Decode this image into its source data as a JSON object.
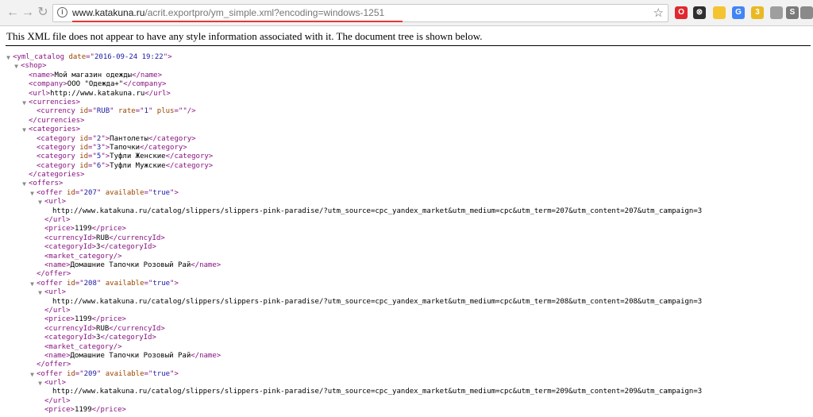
{
  "browser": {
    "url_host": "www.katakuna.ru",
    "url_path": "/acrit.exportpro/ym_simple.xml?encoding=windows-1251",
    "extensions": [
      {
        "name": "opera-icon",
        "color": "#e0282e",
        "glyph": "O"
      },
      {
        "name": "pocket-icon",
        "color": "#2f2f2f",
        "glyph": "⊗"
      },
      {
        "name": "notes-icon",
        "color": "#f4c430",
        "glyph": ""
      },
      {
        "name": "translate-icon",
        "color": "#4285f4",
        "glyph": "G"
      },
      {
        "name": "badge-extension-icon",
        "color": "#e8b923",
        "glyph": "3"
      },
      {
        "name": "ublock-icon",
        "color": "#9e9e9e",
        "glyph": ""
      },
      {
        "name": "skype-icon",
        "color": "#7a7a7a",
        "glyph": "S"
      },
      {
        "name": "evernote-icon",
        "color": "#8a8a8a",
        "glyph": ""
      },
      {
        "name": "menu-icon",
        "color": "#6b6b6b",
        "glyph": "≡"
      }
    ]
  },
  "page": {
    "notice": "This XML file does not appear to have any style information associated with it. The document tree is shown below."
  },
  "xml": {
    "lines": [
      {
        "indent": 0,
        "toggle": "open",
        "parts": [
          [
            "tag",
            "<yml_catalog"
          ],
          [
            "txt",
            " "
          ],
          [
            "aname",
            "date"
          ],
          [
            "tag",
            "=\""
          ],
          [
            "aval",
            "2016-09-24 19:22"
          ],
          [
            "tag",
            "\">"
          ]
        ]
      },
      {
        "indent": 1,
        "toggle": "open",
        "parts": [
          [
            "tag",
            "<shop>"
          ]
        ]
      },
      {
        "indent": 2,
        "toggle": "",
        "parts": [
          [
            "tag",
            "<name>"
          ],
          [
            "txt",
            "Мой магазин одежды"
          ],
          [
            "tag",
            "</name>"
          ]
        ]
      },
      {
        "indent": 2,
        "toggle": "",
        "parts": [
          [
            "tag",
            "<company>"
          ],
          [
            "txt",
            "ООО \"Одежда+\""
          ],
          [
            "tag",
            "</company>"
          ]
        ]
      },
      {
        "indent": 2,
        "toggle": "",
        "parts": [
          [
            "tag",
            "<url>"
          ],
          [
            "txt",
            "http://www.katakuna.ru"
          ],
          [
            "tag",
            "</url>"
          ]
        ]
      },
      {
        "indent": 2,
        "toggle": "open",
        "parts": [
          [
            "tag",
            "<currencies>"
          ]
        ]
      },
      {
        "indent": 3,
        "toggle": "",
        "parts": [
          [
            "tag",
            "<currency"
          ],
          [
            "txt",
            " "
          ],
          [
            "aname",
            "id"
          ],
          [
            "tag",
            "=\""
          ],
          [
            "aval",
            "RUB"
          ],
          [
            "tag",
            "\""
          ],
          [
            "txt",
            " "
          ],
          [
            "aname",
            "rate"
          ],
          [
            "tag",
            "=\""
          ],
          [
            "aval",
            "1"
          ],
          [
            "tag",
            "\""
          ],
          [
            "txt",
            " "
          ],
          [
            "aname",
            "plus"
          ],
          [
            "tag",
            "=\""
          ],
          [
            "aval",
            ""
          ],
          [
            "tag",
            "\"/>"
          ]
        ]
      },
      {
        "indent": 2,
        "toggle": "",
        "parts": [
          [
            "tag",
            "</currencies>"
          ]
        ]
      },
      {
        "indent": 2,
        "toggle": "open",
        "parts": [
          [
            "tag",
            "<categories>"
          ]
        ]
      },
      {
        "indent": 3,
        "toggle": "",
        "parts": [
          [
            "tag",
            "<category"
          ],
          [
            "txt",
            " "
          ],
          [
            "aname",
            "id"
          ],
          [
            "tag",
            "=\""
          ],
          [
            "aval",
            "2"
          ],
          [
            "tag",
            "\">"
          ],
          [
            "txt",
            "Пантолеты"
          ],
          [
            "tag",
            "</category>"
          ]
        ]
      },
      {
        "indent": 3,
        "toggle": "",
        "parts": [
          [
            "tag",
            "<category"
          ],
          [
            "txt",
            " "
          ],
          [
            "aname",
            "id"
          ],
          [
            "tag",
            "=\""
          ],
          [
            "aval",
            "3"
          ],
          [
            "tag",
            "\">"
          ],
          [
            "txt",
            "Тапочки"
          ],
          [
            "tag",
            "</category>"
          ]
        ]
      },
      {
        "indent": 3,
        "toggle": "",
        "parts": [
          [
            "tag",
            "<category"
          ],
          [
            "txt",
            " "
          ],
          [
            "aname",
            "id"
          ],
          [
            "tag",
            "=\""
          ],
          [
            "aval",
            "5"
          ],
          [
            "tag",
            "\">"
          ],
          [
            "txt",
            "Туфли Женские"
          ],
          [
            "tag",
            "</category>"
          ]
        ]
      },
      {
        "indent": 3,
        "toggle": "",
        "parts": [
          [
            "tag",
            "<category"
          ],
          [
            "txt",
            " "
          ],
          [
            "aname",
            "id"
          ],
          [
            "tag",
            "=\""
          ],
          [
            "aval",
            "6"
          ],
          [
            "tag",
            "\">"
          ],
          [
            "txt",
            "Туфли Мужские"
          ],
          [
            "tag",
            "</category>"
          ]
        ]
      },
      {
        "indent": 2,
        "toggle": "",
        "parts": [
          [
            "tag",
            "</categories>"
          ]
        ]
      },
      {
        "indent": 2,
        "toggle": "open",
        "parts": [
          [
            "tag",
            "<offers>"
          ]
        ]
      },
      {
        "indent": 3,
        "toggle": "open",
        "parts": [
          [
            "tag",
            "<offer"
          ],
          [
            "txt",
            " "
          ],
          [
            "aname",
            "id"
          ],
          [
            "tag",
            "=\""
          ],
          [
            "aval",
            "207"
          ],
          [
            "tag",
            "\""
          ],
          [
            "txt",
            " "
          ],
          [
            "aname",
            "available"
          ],
          [
            "tag",
            "=\""
          ],
          [
            "aval",
            "true"
          ],
          [
            "tag",
            "\">"
          ]
        ]
      },
      {
        "indent": 4,
        "toggle": "open",
        "parts": [
          [
            "tag",
            "<url>"
          ]
        ]
      },
      {
        "indent": 5,
        "toggle": "",
        "parts": [
          [
            "txt",
            "http://www.katakuna.ru/catalog/slippers/slippers-pink-paradise/?utm_source=cpc_yandex_market&utm_medium=cpc&utm_term=207&utm_content=207&utm_campaign=3"
          ]
        ]
      },
      {
        "indent": 4,
        "toggle": "",
        "parts": [
          [
            "tag",
            "</url>"
          ]
        ]
      },
      {
        "indent": 4,
        "toggle": "",
        "parts": [
          [
            "tag",
            "<price>"
          ],
          [
            "txt",
            "1199"
          ],
          [
            "tag",
            "</price>"
          ]
        ]
      },
      {
        "indent": 4,
        "toggle": "",
        "parts": [
          [
            "tag",
            "<currencyId>"
          ],
          [
            "txt",
            "RUB"
          ],
          [
            "tag",
            "</currencyId>"
          ]
        ]
      },
      {
        "indent": 4,
        "toggle": "",
        "parts": [
          [
            "tag",
            "<categoryId>"
          ],
          [
            "txt",
            "3"
          ],
          [
            "tag",
            "</categoryId>"
          ]
        ]
      },
      {
        "indent": 4,
        "toggle": "",
        "parts": [
          [
            "tag",
            "<market_category/>"
          ]
        ]
      },
      {
        "indent": 4,
        "toggle": "",
        "parts": [
          [
            "tag",
            "<name>"
          ],
          [
            "txt",
            "Домашние Тапочки Розовый Рай"
          ],
          [
            "tag",
            "</name>"
          ]
        ]
      },
      {
        "indent": 3,
        "toggle": "",
        "parts": [
          [
            "tag",
            "</offer>"
          ]
        ]
      },
      {
        "indent": 3,
        "toggle": "open",
        "parts": [
          [
            "tag",
            "<offer"
          ],
          [
            "txt",
            " "
          ],
          [
            "aname",
            "id"
          ],
          [
            "tag",
            "=\""
          ],
          [
            "aval",
            "208"
          ],
          [
            "tag",
            "\""
          ],
          [
            "txt",
            " "
          ],
          [
            "aname",
            "available"
          ],
          [
            "tag",
            "=\""
          ],
          [
            "aval",
            "true"
          ],
          [
            "tag",
            "\">"
          ]
        ]
      },
      {
        "indent": 4,
        "toggle": "open",
        "parts": [
          [
            "tag",
            "<url>"
          ]
        ]
      },
      {
        "indent": 5,
        "toggle": "",
        "parts": [
          [
            "txt",
            "http://www.katakuna.ru/catalog/slippers/slippers-pink-paradise/?utm_source=cpc_yandex_market&utm_medium=cpc&utm_term=208&utm_content=208&utm_campaign=3"
          ]
        ]
      },
      {
        "indent": 4,
        "toggle": "",
        "parts": [
          [
            "tag",
            "</url>"
          ]
        ]
      },
      {
        "indent": 4,
        "toggle": "",
        "parts": [
          [
            "tag",
            "<price>"
          ],
          [
            "txt",
            "1199"
          ],
          [
            "tag",
            "</price>"
          ]
        ]
      },
      {
        "indent": 4,
        "toggle": "",
        "parts": [
          [
            "tag",
            "<currencyId>"
          ],
          [
            "txt",
            "RUB"
          ],
          [
            "tag",
            "</currencyId>"
          ]
        ]
      },
      {
        "indent": 4,
        "toggle": "",
        "parts": [
          [
            "tag",
            "<categoryId>"
          ],
          [
            "txt",
            "3"
          ],
          [
            "tag",
            "</categoryId>"
          ]
        ]
      },
      {
        "indent": 4,
        "toggle": "",
        "parts": [
          [
            "tag",
            "<market_category/>"
          ]
        ]
      },
      {
        "indent": 4,
        "toggle": "",
        "parts": [
          [
            "tag",
            "<name>"
          ],
          [
            "txt",
            "Домашние Тапочки Розовый Рай"
          ],
          [
            "tag",
            "</name>"
          ]
        ]
      },
      {
        "indent": 3,
        "toggle": "",
        "parts": [
          [
            "tag",
            "</offer>"
          ]
        ]
      },
      {
        "indent": 3,
        "toggle": "open",
        "parts": [
          [
            "tag",
            "<offer"
          ],
          [
            "txt",
            " "
          ],
          [
            "aname",
            "id"
          ],
          [
            "tag",
            "=\""
          ],
          [
            "aval",
            "209"
          ],
          [
            "tag",
            "\""
          ],
          [
            "txt",
            " "
          ],
          [
            "aname",
            "available"
          ],
          [
            "tag",
            "=\""
          ],
          [
            "aval",
            "true"
          ],
          [
            "tag",
            "\">"
          ]
        ]
      },
      {
        "indent": 4,
        "toggle": "open",
        "parts": [
          [
            "tag",
            "<url>"
          ]
        ]
      },
      {
        "indent": 5,
        "toggle": "",
        "parts": [
          [
            "txt",
            "http://www.katakuna.ru/catalog/slippers/slippers-pink-paradise/?utm_source=cpc_yandex_market&utm_medium=cpc&utm_term=209&utm_content=209&utm_campaign=3"
          ]
        ]
      },
      {
        "indent": 4,
        "toggle": "",
        "parts": [
          [
            "tag",
            "</url>"
          ]
        ]
      },
      {
        "indent": 4,
        "toggle": "",
        "parts": [
          [
            "tag",
            "<price>"
          ],
          [
            "txt",
            "1199"
          ],
          [
            "tag",
            "</price>"
          ]
        ]
      }
    ]
  }
}
